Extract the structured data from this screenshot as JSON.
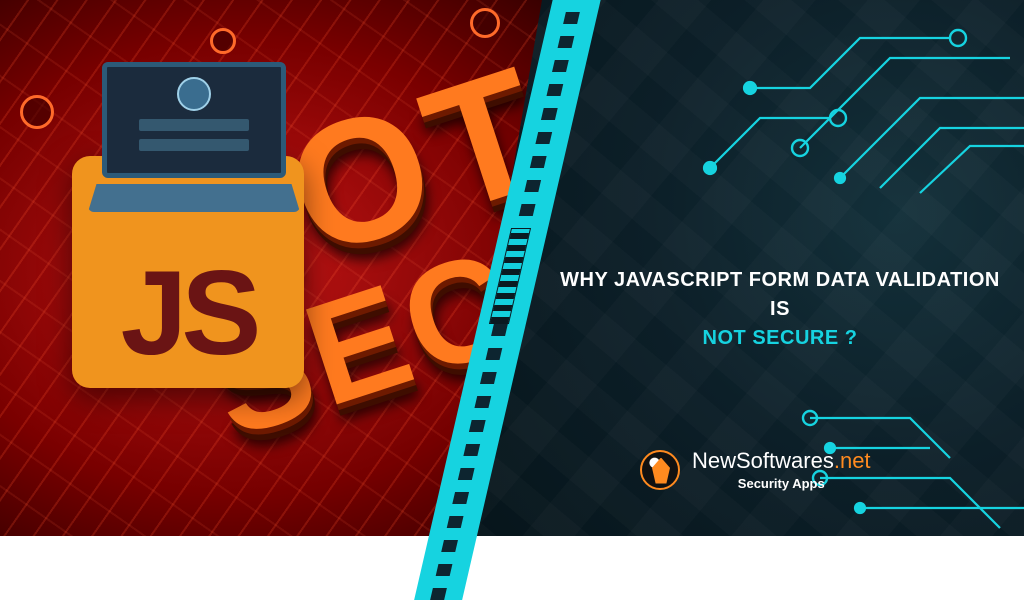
{
  "left": {
    "stamp_line1": "NOT",
    "stamp_line2": "SECURE",
    "js_label": "JS"
  },
  "headline": {
    "line1": "WHY JAVASCRIPT FORM DATA VALIDATION IS",
    "emphasis": "NOT SECURE ?"
  },
  "brand": {
    "name_main": "NewSoftwares",
    "name_suffix": ".net",
    "tagline": "Security Apps"
  },
  "colors": {
    "accent_cyan": "#16d3e0",
    "accent_orange": "#ff8a1f",
    "js_bg": "#f0941e",
    "js_fg": "#6a1414"
  }
}
